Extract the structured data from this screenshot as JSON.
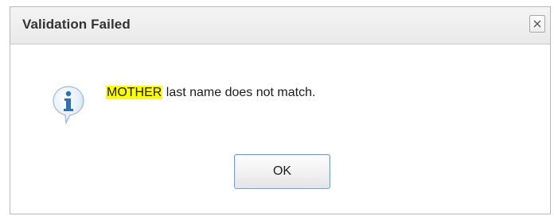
{
  "dialog": {
    "title": "Validation Failed",
    "close_icon": "close-icon",
    "info_icon": "info-icon",
    "message_highlight": "MOTHER",
    "message_rest": " last name does not match.",
    "ok_label": "OK",
    "colors": {
      "highlight": "#ffff00",
      "button_border": "#7a9fd6",
      "icon_blue": "#2f6fb5"
    }
  }
}
